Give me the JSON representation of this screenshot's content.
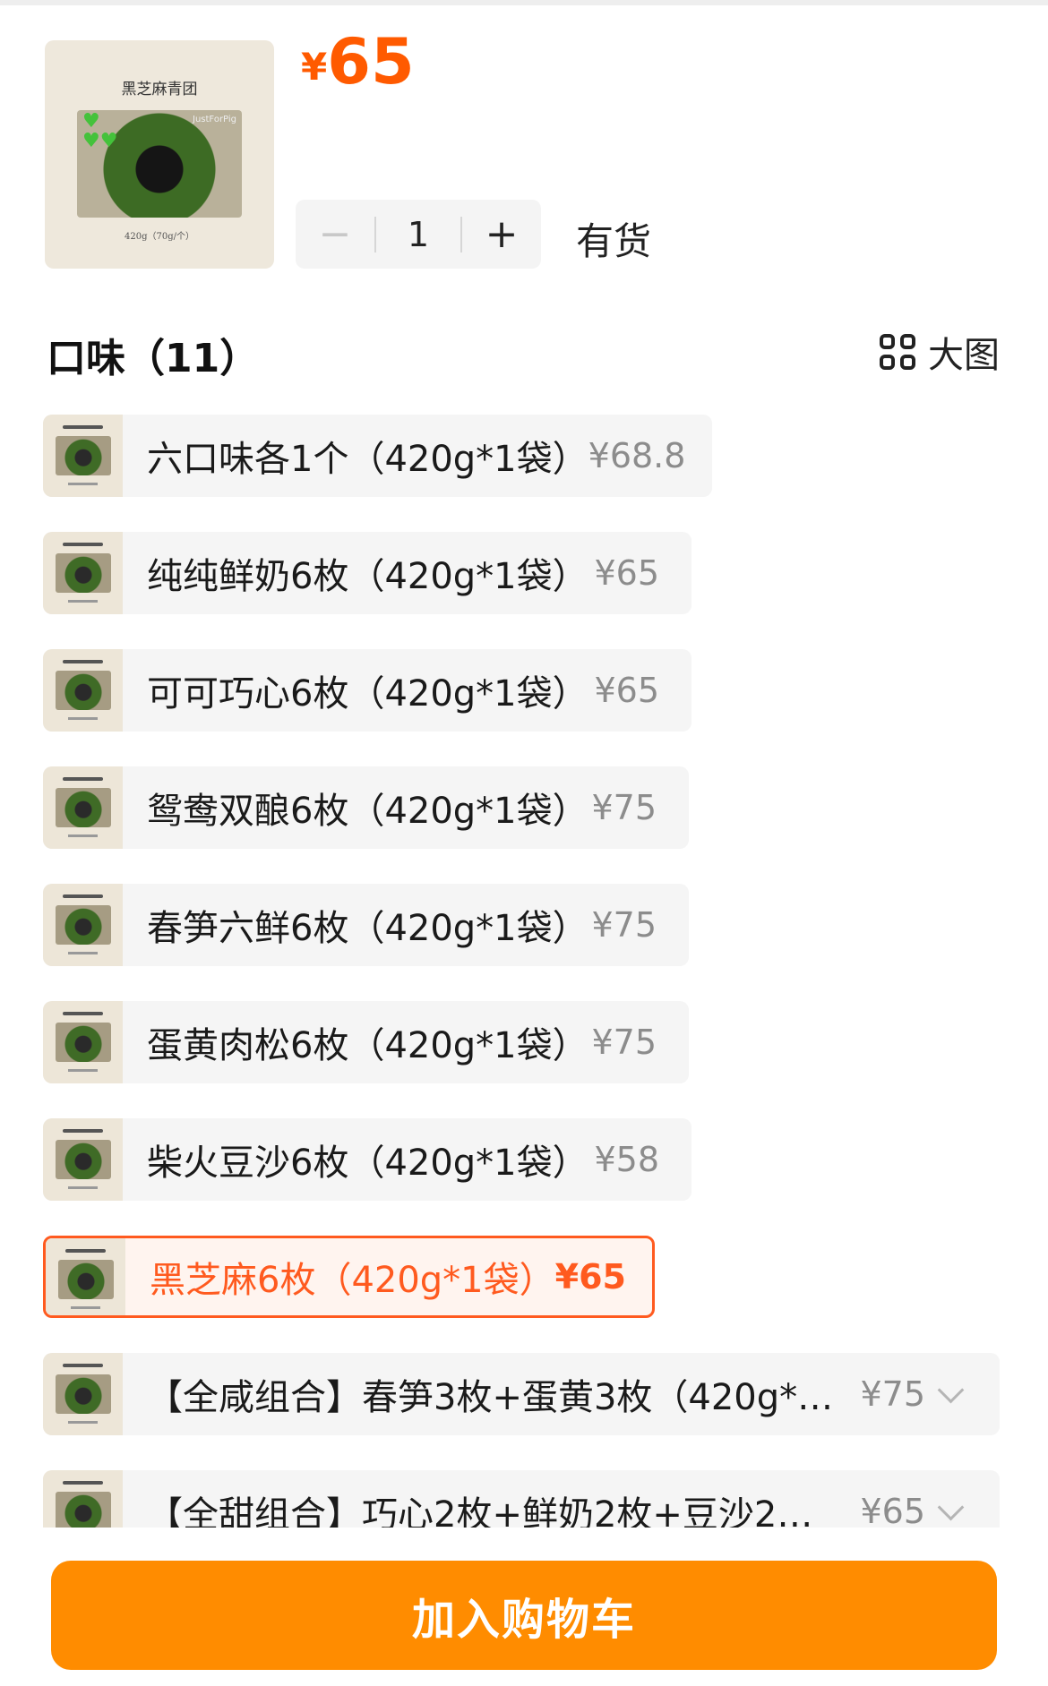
{
  "product": {
    "thumb_title": "黑芝麻青团",
    "thumb_brand": "JustForPig",
    "thumb_weight": "420g（70g/个）",
    "price_currency": "¥",
    "price_value": "65"
  },
  "quantity": {
    "minus": "−",
    "value": "1",
    "plus": "+"
  },
  "stock_status": "有货",
  "flavor_section": {
    "title": "口味（11）",
    "big_view_label": "大图"
  },
  "options": [
    {
      "label": "六口味各1个（420g*1袋）",
      "price": "¥68.8",
      "selected": false
    },
    {
      "label": "纯纯鲜奶6枚（420g*1袋）",
      "price": "¥65",
      "selected": false
    },
    {
      "label": "可可巧心6枚（420g*1袋）",
      "price": "¥65",
      "selected": false
    },
    {
      "label": "鸳鸯双酿6枚（420g*1袋）",
      "price": "¥75",
      "selected": false
    },
    {
      "label": "春笋六鲜6枚（420g*1袋）",
      "price": "¥75",
      "selected": false
    },
    {
      "label": "蛋黄肉松6枚（420g*1袋）",
      "price": "¥75",
      "selected": false
    },
    {
      "label": "柴火豆沙6枚（420g*1袋）",
      "price": "¥58",
      "selected": false
    },
    {
      "label": "黑芝麻6枚（420g*1袋）",
      "price": "¥65",
      "selected": true
    },
    {
      "label": "【全咸组合】春笋3枚+蛋黄3枚（420g*1...",
      "price": "¥75",
      "selected": false
    },
    {
      "label": "【全甜组合】巧心2枚+鲜奶2枚+豆沙2枚...",
      "price": "¥65",
      "selected": false
    }
  ],
  "cart_button": "加入购物车",
  "colors": {
    "accent": "#ff5a00",
    "cart_button": "#ff8c00",
    "selected_border": "#ff5a1f"
  }
}
